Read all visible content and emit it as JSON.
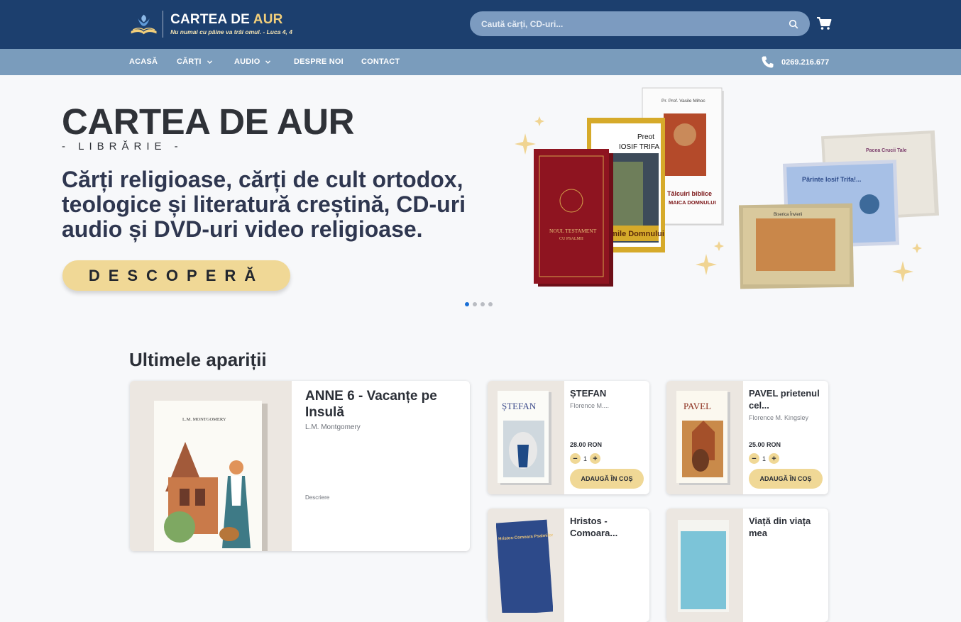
{
  "brand": {
    "name_part1": "CARTEA DE ",
    "name_part2": "AUR",
    "motto": "Nu numai cu pâine va trăi omul. - Luca 4, 4"
  },
  "search": {
    "placeholder": "Caută cărți, CD-uri..."
  },
  "icons": {
    "search": "search-icon",
    "cart": "cart-icon",
    "phone": "phone-icon",
    "chevron": "chevron-down-icon"
  },
  "nav": {
    "items": [
      {
        "label": "ACASĂ"
      },
      {
        "label": "CĂRȚI"
      },
      {
        "label": "AUDIO"
      },
      {
        "label": "DESPRE NOI"
      },
      {
        "label": "CONTACT"
      }
    ],
    "phone": "0269.216.677"
  },
  "hero": {
    "title_part1": "CARTEA DE ",
    "title_part2": "AUR",
    "subtitle": "- LIBRĂRIE -",
    "text": "Cărți religioase, cărți de cult ortodox, teologice și literatură creștină, CD-uri audio și DVD-uri video religioase.",
    "cta": "DESCOPERĂ",
    "book_labels": {
      "red_book_title": "NOUL TESTAMENT",
      "red_book_sub": "CU PSALMII",
      "icon_book_author": "Pr. Prof. Vasile Mihoc",
      "icon_book_title": "Tâlcuiri biblice",
      "icon_book_sub": "MAICA DOMNULUI",
      "trifa_book_author": "Preot",
      "trifa_book_name": "IOSIF TRIFA",
      "trifa_book_title": "Patimile Domnului",
      "cd1_title": "Părinte Iosif Trifa!...",
      "cd2_title": "Pacea Crucii Tale",
      "cd3_title": "Biserica Învierii"
    },
    "slides_total": 4,
    "active_slide": 1
  },
  "colors": {
    "header": "#1c3f6e",
    "nav": "#7a9cbc",
    "gold": "#f0d896",
    "dot_active": "#1a6fd6"
  },
  "section": {
    "title": "Ultimele apariții"
  },
  "products": {
    "featured": {
      "title": "ANNE 6 - Vacanțe pe Insulă",
      "author": "L.M. Montgomery",
      "desc_label": "Descriere",
      "cover_author": "L.M. MONTGOMERY"
    },
    "items": [
      {
        "title": "ȘTEFAN",
        "author": "Florence M....",
        "price": "28.00 RON",
        "qty": "1",
        "add": "ADAUGĂ ÎN COȘ",
        "cover_title": "ȘTEFAN"
      },
      {
        "title": "PAVEL prietenul cel...",
        "author": "Florence M. Kingsley",
        "price": "25.00 RON",
        "qty": "1",
        "add": "ADAUGĂ ÎN COȘ",
        "cover_title": "PAVEL"
      },
      {
        "title": "Hristos - Comoara...",
        "cover_title": "Hristos-Comoara Psalmilor"
      },
      {
        "title": "Viață din viața mea"
      }
    ]
  }
}
